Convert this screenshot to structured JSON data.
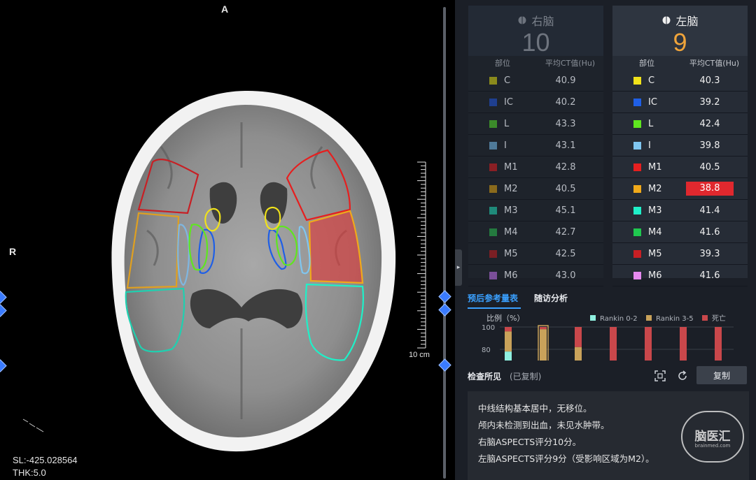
{
  "viewer": {
    "orient_top": "A",
    "orient_left": "R",
    "scale_label": "10 cm",
    "sl_text": "SL:-425.028564",
    "thk_text": "THK:5.0"
  },
  "right_hemi": {
    "title": "右脑",
    "score": "10",
    "col_region": "部位",
    "col_ct": "平均CT值(Hu)",
    "rows": [
      {
        "name": "C",
        "value": "40.9",
        "color": "#8a8a1c"
      },
      {
        "name": "IC",
        "value": "40.2",
        "color": "#1f3f8f"
      },
      {
        "name": "L",
        "value": "43.3",
        "color": "#3b8a2a"
      },
      {
        "name": "I",
        "value": "43.1",
        "color": "#4f7a99"
      },
      {
        "name": "M1",
        "value": "42.8",
        "color": "#8a1f24"
      },
      {
        "name": "M2",
        "value": "40.5",
        "color": "#8a6a1c"
      },
      {
        "name": "M3",
        "value": "45.1",
        "color": "#1f8a7a"
      },
      {
        "name": "M4",
        "value": "42.7",
        "color": "#247a3f"
      },
      {
        "name": "M5",
        "value": "42.5",
        "color": "#7a1f24"
      },
      {
        "name": "M6",
        "value": "43.0",
        "color": "#7a4f99"
      }
    ]
  },
  "left_hemi": {
    "title": "左脑",
    "score": "9",
    "col_region": "部位",
    "col_ct": "平均CT值(Hu)",
    "rows": [
      {
        "name": "C",
        "value": "40.3",
        "color": "#f0e21a",
        "highlight": false
      },
      {
        "name": "IC",
        "value": "39.2",
        "color": "#1f5fe6",
        "highlight": false
      },
      {
        "name": "L",
        "value": "42.4",
        "color": "#5fe61f",
        "highlight": false
      },
      {
        "name": "I",
        "value": "39.8",
        "color": "#7fc6f0",
        "highlight": false
      },
      {
        "name": "M1",
        "value": "40.5",
        "color": "#e61f1f",
        "highlight": false
      },
      {
        "name": "M2",
        "value": "38.8",
        "color": "#f0a91a",
        "highlight": true
      },
      {
        "name": "M3",
        "value": "41.4",
        "color": "#1ff0c8",
        "highlight": false
      },
      {
        "name": "M4",
        "value": "41.6",
        "color": "#1fc84f",
        "highlight": false
      },
      {
        "name": "M5",
        "value": "39.3",
        "color": "#c81f24",
        "highlight": false
      },
      {
        "name": "M6",
        "value": "41.6",
        "color": "#e68af0",
        "highlight": false
      }
    ]
  },
  "colors": {
    "accent_blue": "#3aa0ff",
    "score_orange": "#f0a43a",
    "highlight_red": "#e0282e"
  },
  "tabs": {
    "prognosis": "预后参考量表",
    "followup": "随访分析"
  },
  "chart_data": {
    "type": "bar",
    "ylabel": "比例（%）",
    "y_ticks": [
      100,
      80
    ],
    "legend": [
      "Rankin 0-2",
      "Rankin 3-5",
      "死亡"
    ],
    "legend_colors": [
      "#8ff0e0",
      "#c9a25a",
      "#c9474b"
    ],
    "bars": [
      {
        "rankin02": 16,
        "rankin35": 18,
        "death": 4
      },
      {
        "rankin02": 10,
        "rankin35": 30,
        "death": 2,
        "selected": true
      },
      {
        "rankin02": 6,
        "rankin35": 15,
        "death": 18
      },
      {
        "rankin02": 0,
        "rankin35": 10,
        "death": 30
      },
      {
        "rankin02": 0,
        "rankin35": 0,
        "death": 40
      },
      {
        "rankin02": 0,
        "rankin35": 0,
        "death": 40
      },
      {
        "rankin02": 0,
        "rankin35": 0,
        "death": 40
      }
    ]
  },
  "findings": {
    "title": "检查所见",
    "status": "(已复制)",
    "copy_label": "复制",
    "lines": [
      "中线结构基本居中，无移位。",
      "颅内未检测到出血，未见水肿带。",
      "右脑ASPECTS评分10分。",
      "左脑ASPECTS评分9分（受影响区域为M2）。"
    ],
    "logo_text": "脑医汇",
    "logo_sub": "brainmed.com"
  }
}
